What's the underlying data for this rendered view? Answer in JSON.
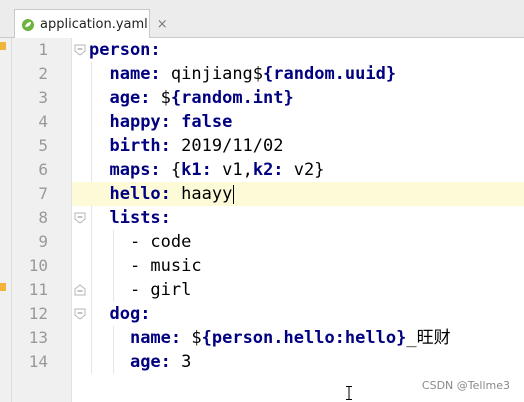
{
  "tab": {
    "label": "application.yaml",
    "close": "×"
  },
  "gutter": {
    "line_numbers": [
      "1",
      "2",
      "3",
      "4",
      "5",
      "6",
      "7",
      "8",
      "9",
      "10",
      "11",
      "12",
      "13",
      "14"
    ]
  },
  "code": {
    "l1": {
      "key": "person:"
    },
    "l2": {
      "key": "name:",
      "val": " qinjiang$",
      "tpl": "{random.uuid}"
    },
    "l3": {
      "key": "age:",
      "val": " $",
      "tpl": "{random.int}"
    },
    "l4": {
      "key": "happy:",
      "tpl": " false"
    },
    "l5": {
      "key": "birth:",
      "val": " 2019/11/02"
    },
    "l6": {
      "key": "maps:",
      "val1": " {",
      "k1": "k1:",
      "val2": " v1,",
      "k2": "k2:",
      "val3": " v2}"
    },
    "l7": {
      "key": "hello:",
      "val": " haayy"
    },
    "l8": {
      "key": "lists:"
    },
    "l9": {
      "val": "- code"
    },
    "l10": {
      "val": "- music"
    },
    "l11": {
      "val": "- girl"
    },
    "l12": {
      "key": "dog:"
    },
    "l13": {
      "key": "name:",
      "val": " $",
      "tpl": "{person.hello:hello}",
      "tail": "_旺财"
    },
    "l14": {
      "key": "age:",
      "val": " 3"
    }
  },
  "watermark": "CSDN @Tellme3",
  "colors": {
    "key": "#000080",
    "current_line": "#fcfad7",
    "gutter": "#f0f0f0"
  }
}
